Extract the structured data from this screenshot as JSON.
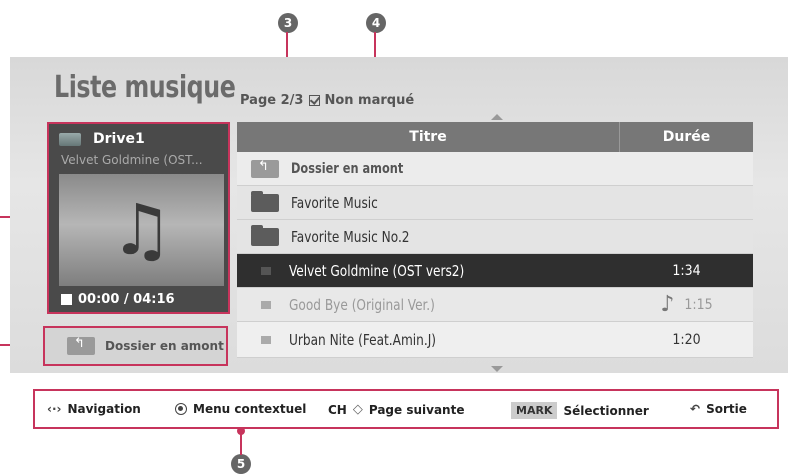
{
  "callouts": [
    "3",
    "4",
    "5"
  ],
  "header": {
    "title": "Liste musique",
    "page_text": "Page 2/3",
    "filter_label": "Non marqué"
  },
  "player": {
    "drive_name": "Drive1",
    "song_name": "Velvet Goldmine (OST...",
    "time": "00:00 / 04:16",
    "up_button_label": "Dossier en amont"
  },
  "list": {
    "col_title": "Titre",
    "col_duration": "Durée",
    "rows": [
      {
        "title": "Dossier en amont",
        "duration": ""
      },
      {
        "title": "Favorite Music",
        "duration": ""
      },
      {
        "title": "Favorite Music No.2",
        "duration": ""
      },
      {
        "title": "Velvet Goldmine (OST vers2)",
        "duration": "1:34"
      },
      {
        "title": "Good Bye (Original Ver.)",
        "duration": "1:15"
      },
      {
        "title": "Urban Nite (Feat.Amin.J)",
        "duration": "1:20"
      }
    ]
  },
  "footer": {
    "navigation": "Navigation",
    "context_menu": "Menu contextuel",
    "ch_label": "CH",
    "next_page": "Page suivante",
    "mark_badge": "MARK",
    "select": "Sélectionner",
    "exit": "Sortie"
  },
  "icons": {
    "music_note": "♫",
    "note_single": "♪"
  },
  "colors": {
    "callout_line": "#c7345c",
    "selected_row": "#2f2f2f"
  }
}
